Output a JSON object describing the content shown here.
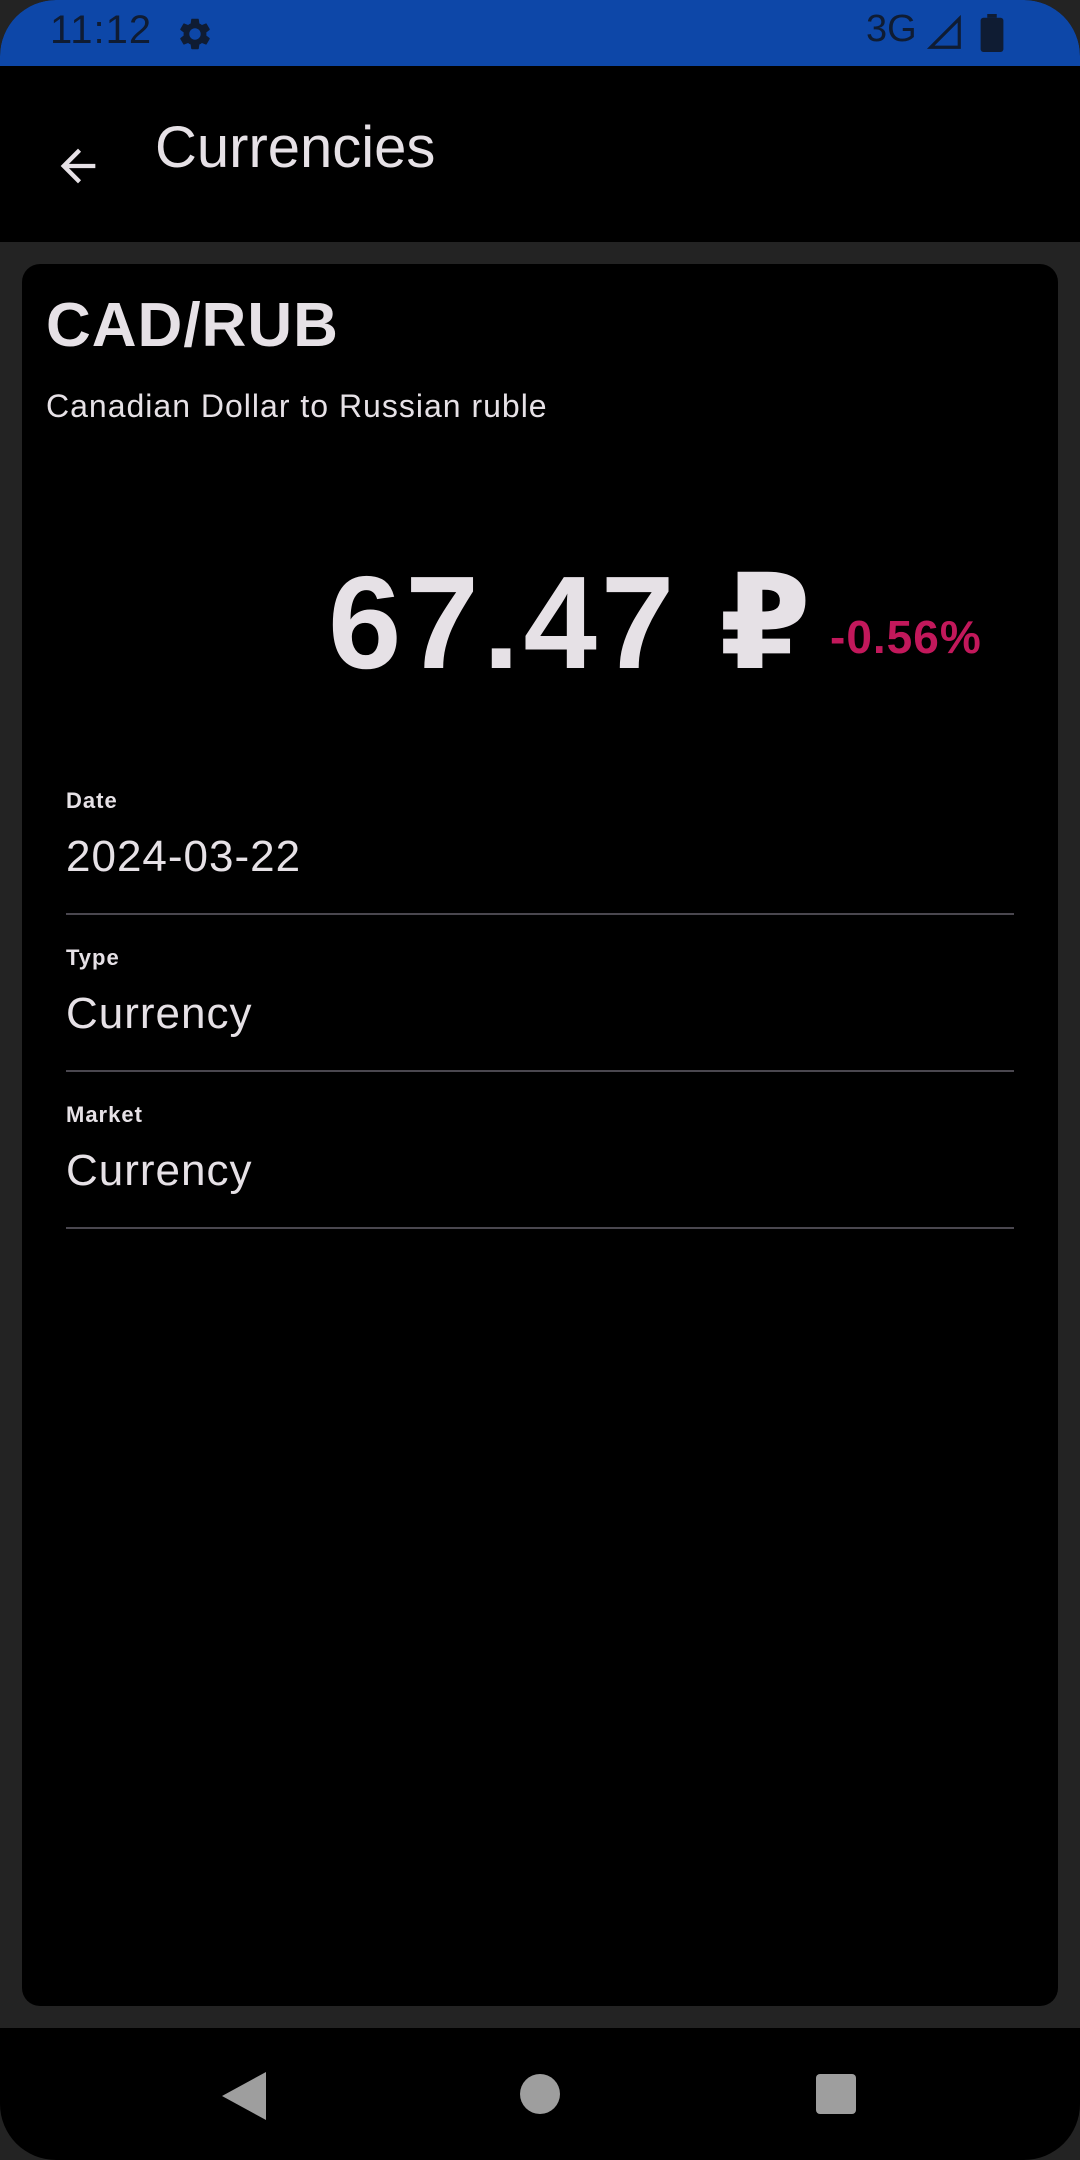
{
  "status_bar": {
    "time": "11:12",
    "network": "3G",
    "color": "#0d47a8"
  },
  "app_bar": {
    "title": "Currencies",
    "back_icon": "arrow-left-icon"
  },
  "detail": {
    "pair": "CAD/RUB",
    "description": "Canadian Dollar to Russian ruble",
    "price": "67.47 ₽",
    "change": "-0.56%",
    "change_color": "#c2185b",
    "fields": [
      {
        "label": "Date",
        "value": "2024-03-22"
      },
      {
        "label": "Type",
        "value": "Currency"
      },
      {
        "label": "Market",
        "value": "Currency"
      }
    ]
  },
  "nav_bar": {
    "icons": [
      "nav-back-icon",
      "nav-home-icon",
      "nav-recents-icon"
    ]
  }
}
